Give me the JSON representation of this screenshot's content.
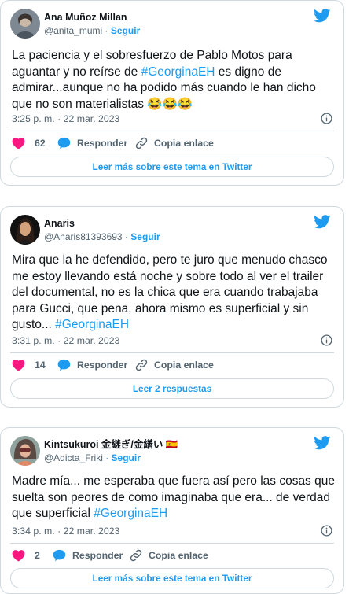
{
  "tweets": [
    {
      "name": "Ana Muñoz Millan",
      "handle": "@anita_mumi",
      "sep": " · ",
      "follow": "Seguir",
      "text_a": "La paciencia y el sobresfuerzo de Pablo Motos para aguantar y no reírse de ",
      "hashtag": "#GeorginaEH",
      "text_b": " es digno de admirar...aunque no ha podido más cuando le han dicho que no son materialistas ",
      "emoji": "😂😂😂",
      "time": "3:25 p. m. · 22 mar. 2023",
      "likes": "62",
      "reply": "Responder",
      "copy": "Copia enlace",
      "more": "Leer más sobre este tema en Twitter",
      "avatar_colors": [
        "#6d7a86",
        "#c9b8a6"
      ]
    },
    {
      "name": "Anaris",
      "handle": "@Anaris81393693",
      "sep": " · ",
      "follow": "Seguir",
      "text_a": "Mira que la he defendido, pero te juro que menudo chasco me estoy llevando está noche y sobre todo al ver el trailer del documental, no es la chica que era cuando trabajaba para Gucci, que pena, ahora mismo es superficial y sin gusto... ",
      "hashtag": "#GeorginaEH",
      "text_b": "",
      "emoji": "",
      "time": "3:31 p. m. · 22 mar. 2023",
      "likes": "14",
      "reply": "Responder",
      "copy": "Copia enlace",
      "more": "Leer 2 respuestas",
      "avatar_colors": [
        "#1a1a1a",
        "#d4a27c"
      ]
    },
    {
      "name": "Kintsukuroi 金継ぎ/金繕い",
      "flag": "🇪🇸",
      "handle": "@Adicta_Friki",
      "sep": " · ",
      "follow": "Seguir",
      "text_a": "Madre mía... me esperaba que fuera así pero las cosas que suelta son peores de como imaginaba que era... de verdad que superficial ",
      "hashtag": "#GeorginaEH",
      "text_b": "",
      "emoji": "",
      "time": "3:34 p. m. · 22 mar. 2023",
      "likes": "2",
      "reply": "Responder",
      "copy": "Copia enlace",
      "more": "Leer más sobre este tema en Twitter",
      "avatar_colors": [
        "#7a8e8a",
        "#e08a6a"
      ]
    }
  ],
  "colors": {
    "accent": "#1d9bf0",
    "like": "#f91880",
    "muted": "#536471",
    "border": "#cfd9de"
  },
  "icons": [
    "twitter-bird-icon",
    "info-icon",
    "heart-icon",
    "reply-bubble-icon",
    "link-icon"
  ]
}
